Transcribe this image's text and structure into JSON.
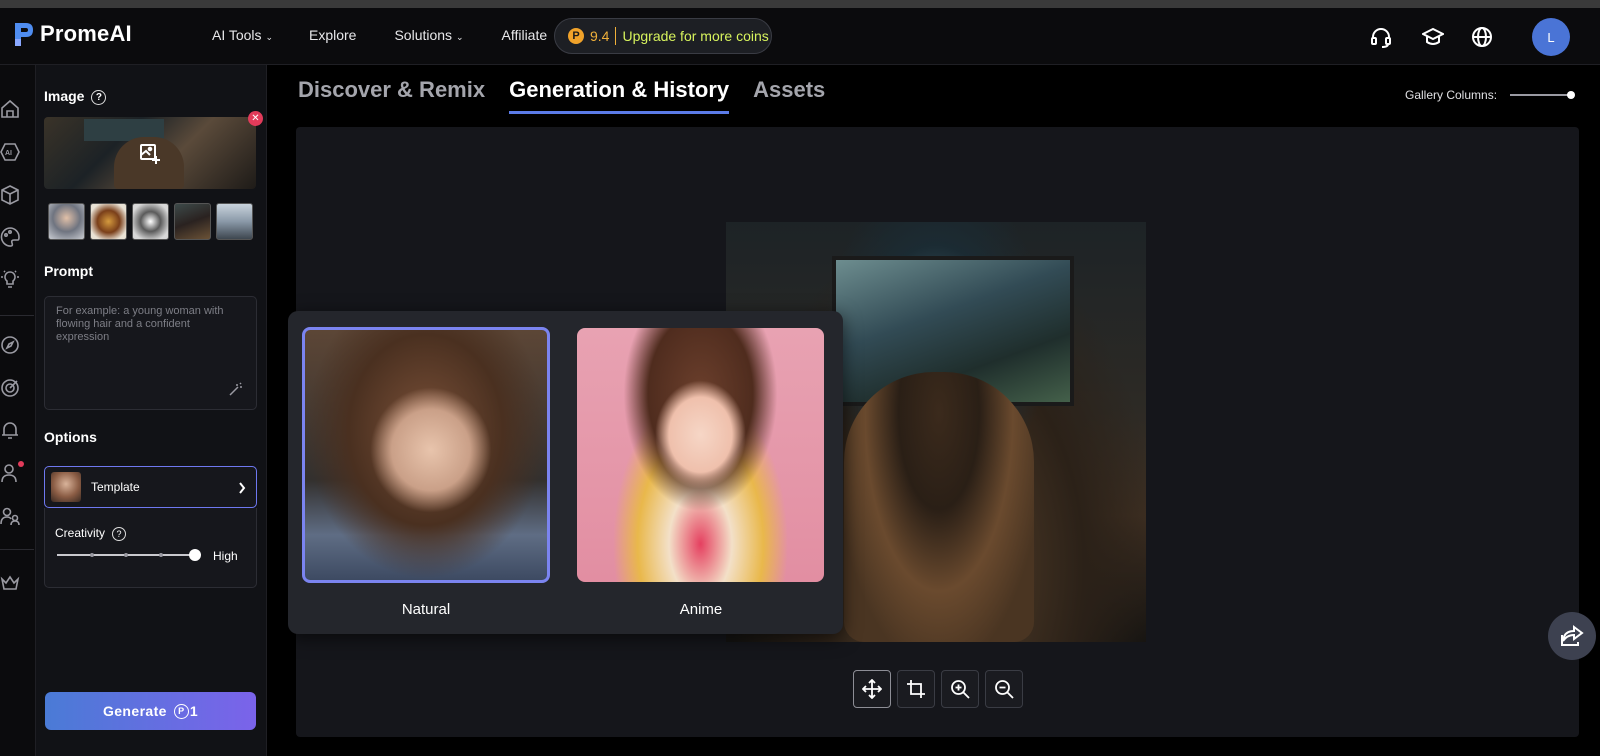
{
  "header": {
    "logo": "PromeAI",
    "nav": [
      {
        "label": "AI Tools",
        "dropdown": true
      },
      {
        "label": "Explore",
        "dropdown": false
      },
      {
        "label": "Solutions",
        "dropdown": true
      },
      {
        "label": "Affiliate",
        "dropdown": false
      }
    ],
    "coins": {
      "value": "9.4",
      "upgrade_label": "Upgrade for more coins",
      "coin_glyph": "P"
    },
    "icons": [
      "headset-icon",
      "graduation-cap-icon",
      "globe-icon"
    ],
    "avatar_letter": "L"
  },
  "rail": {
    "icons": [
      "home-icon",
      "ai-icon",
      "cube-icon",
      "palette-icon",
      "lightbulb-icon",
      "compass-icon",
      "target-icon",
      "bell-icon",
      "user-icon",
      "users-icon",
      "crown-icon"
    ]
  },
  "left": {
    "image_label": "Image",
    "help_glyph": "?",
    "remove_glyph": "✕",
    "prompt_label": "Prompt",
    "prompt_placeholder": "For example: a young woman with flowing hair and a confident expression",
    "options_label": "Options",
    "template_label": "Template",
    "creativity_label": "Creativity",
    "creativity_value": "High",
    "generate_label": "Generate",
    "generate_cost": "1",
    "generate_coin_glyph": "P"
  },
  "tabs": [
    {
      "label": "Discover & Remix",
      "active": false
    },
    {
      "label": "Generation & History",
      "active": true
    },
    {
      "label": "Assets",
      "active": false
    }
  ],
  "gallery_columns_label": "Gallery Columns:",
  "popup": {
    "options": [
      {
        "label": "Natural",
        "selected": true
      },
      {
        "label": "Anime",
        "selected": false
      }
    ]
  },
  "toolbar": [
    "move-icon",
    "crop-icon",
    "zoom-in-icon",
    "zoom-out-icon"
  ],
  "colors": {
    "accent": "#6e78f0",
    "upgrade": "#d7f35d",
    "coin": "#f0b03a",
    "remove": "#e23b5a"
  }
}
